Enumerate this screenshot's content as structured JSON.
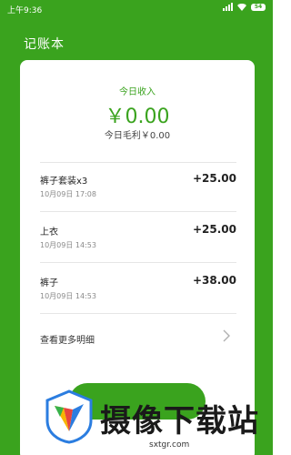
{
  "status_bar": {
    "time": "上午9:36",
    "battery": "54"
  },
  "app": {
    "title": "记账本"
  },
  "summary": {
    "label": "今日收入",
    "amount": "￥0.00",
    "profit": "今日毛利￥0.00"
  },
  "records": [
    {
      "name": "裤子套装x3",
      "time": "10月09日 17:08",
      "amount": "+25.00"
    },
    {
      "name": "上衣",
      "time": "10月09日 14:53",
      "amount": "+25.00"
    },
    {
      "name": "裤子",
      "time": "10月09日 14:53",
      "amount": "+38.00"
    }
  ],
  "more": {
    "label": "查看更多明细"
  },
  "watermark": {
    "text": "摄像下载站",
    "url": "sxtgr.com"
  },
  "colors": {
    "brand_green": "#3aa31e",
    "card_bg": "#ffffff"
  },
  "icons": [
    "signal-icon",
    "wifi-icon",
    "battery-icon",
    "chevron-right-icon",
    "logo-icon"
  ]
}
